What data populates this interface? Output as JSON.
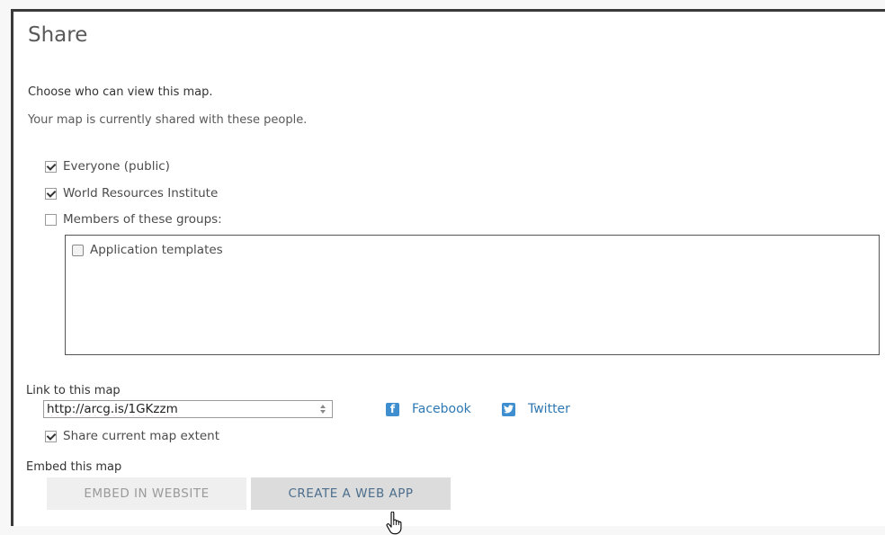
{
  "dialog": {
    "title": "Share",
    "subheading": "Choose who can view this map.",
    "description": "Your map is currently shared with these people."
  },
  "sharing": {
    "options": [
      {
        "label": "Everyone (public)",
        "checked": true
      },
      {
        "label": "World Resources Institute",
        "checked": true
      },
      {
        "label": "Members of these groups:",
        "checked": false
      }
    ],
    "groups": [
      {
        "label": "Application templates",
        "checked": false
      }
    ]
  },
  "link": {
    "label": "Link to this map",
    "url": "http://arcg.is/1GKzzm",
    "share_extent_label": "Share current map extent",
    "share_extent_checked": true,
    "facebook_label": "Facebook",
    "twitter_label": "Twitter",
    "facebook_icon": "f",
    "twitter_icon": "t"
  },
  "embed": {
    "label": "Embed this map",
    "embed_button": "EMBED IN WEBSITE",
    "create_button": "CREATE A WEB APP"
  },
  "colors": {
    "link": "#2e78b3",
    "social_icon": "#3f8fd0",
    "button_primary_bg": "#dcdcdc",
    "button_disabled_bg": "#efefef"
  }
}
